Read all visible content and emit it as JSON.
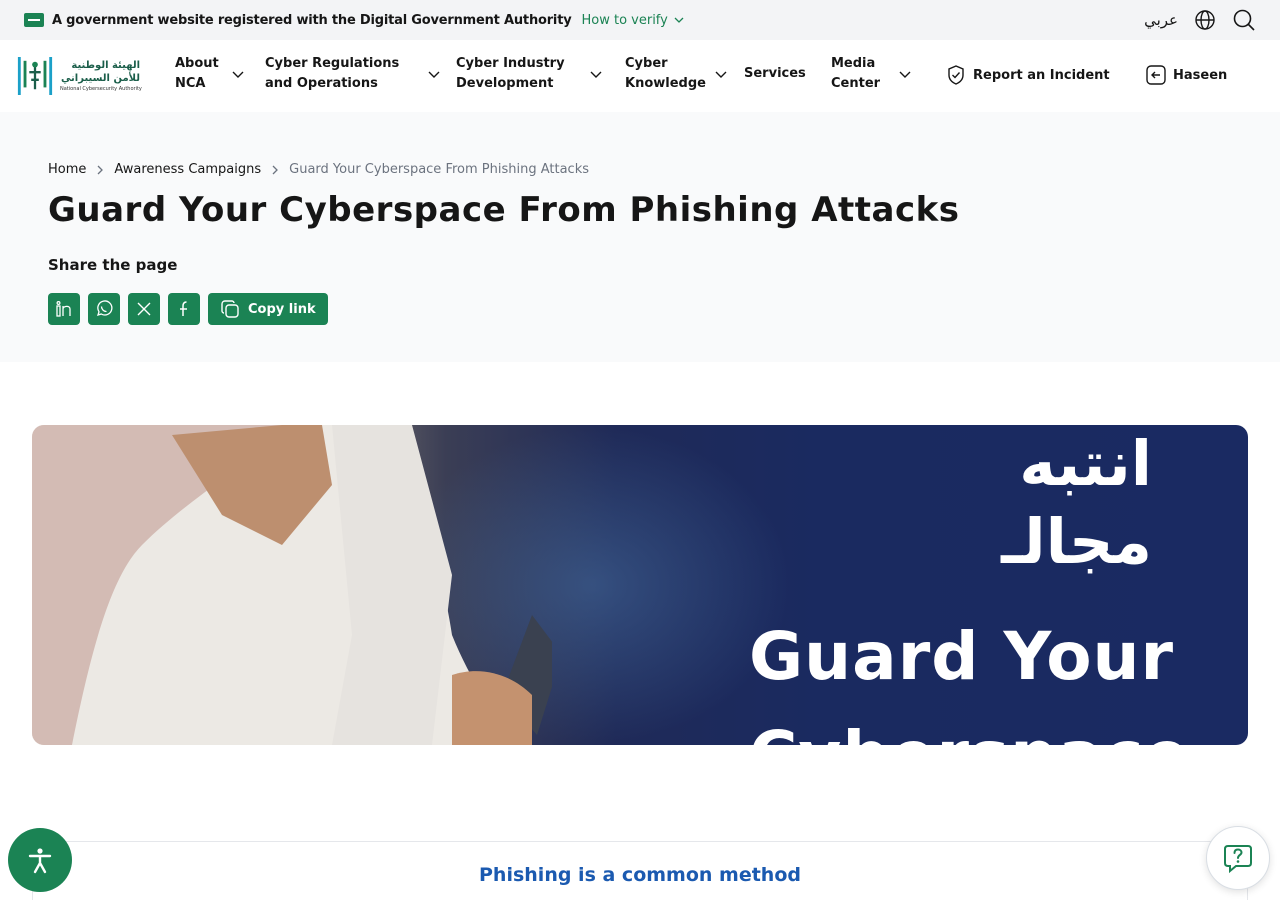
{
  "gov_bar": {
    "text": "A government website registered with the Digital Government Authority",
    "verify_label": "How to verify",
    "lang_label": "عربي"
  },
  "logo": {
    "arabic_line1": "الهيئة الوطنية",
    "arabic_line2": "للأمن السيبراني",
    "english": "National Cybersecurity Authority"
  },
  "nav": {
    "items": [
      {
        "label": "About\nNCA"
      },
      {
        "label": "Cyber Regulations\nand Operations"
      },
      {
        "label": "Cyber Industry\nDevelopment"
      },
      {
        "label": "Cyber\nKnowledge"
      },
      {
        "label": "Services"
      },
      {
        "label": "Media\nCenter"
      }
    ],
    "report_label": "Report an Incident",
    "haseen_label": "Haseen"
  },
  "breadcrumb": {
    "items": [
      "Home",
      "Awareness Campaigns",
      "Guard Your Cyberspace From Phishing Attacks"
    ]
  },
  "page": {
    "title": "Guard Your Cyberspace From Phishing Attacks",
    "share_label": "Share the page",
    "copy_link_label": "Copy link"
  },
  "banner": {
    "arabic_line1": "انتبه",
    "arabic_line2": "مجالـ",
    "english_line1": "Guard Your",
    "english_line2": "Cyberspace"
  },
  "article": {
    "heading": "Phishing is a common method"
  },
  "colors": {
    "primary": "#1b8354",
    "heading_blue": "#1b5ab0",
    "muted": "#6c737f"
  }
}
